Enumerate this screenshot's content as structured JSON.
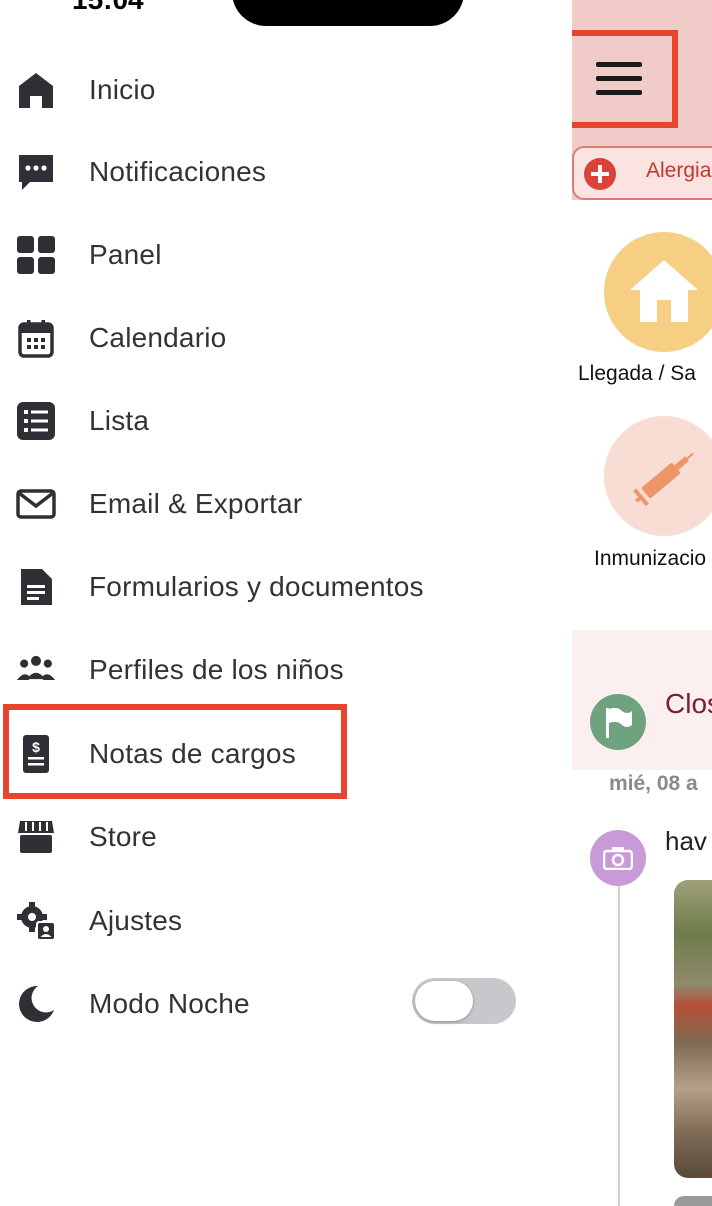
{
  "status_bar": {
    "time": "15:04"
  },
  "menu": {
    "items": [
      {
        "label": "Inicio",
        "icon": "home-icon"
      },
      {
        "label": "Notificaciones",
        "icon": "chat-bubble-icon"
      },
      {
        "label": "Panel",
        "icon": "grid-icon"
      },
      {
        "label": "Calendario",
        "icon": "calendar-icon"
      },
      {
        "label": "Lista",
        "icon": "list-icon"
      },
      {
        "label": "Email & Exportar",
        "icon": "envelope-icon"
      },
      {
        "label": "Formularios y documentos",
        "icon": "document-icon"
      },
      {
        "label": "Perfiles de los niños",
        "icon": "group-icon"
      },
      {
        "label": "Notas de cargos",
        "icon": "invoice-icon"
      },
      {
        "label": "Store",
        "icon": "store-icon"
      },
      {
        "label": "Ajustes",
        "icon": "settings-icon"
      },
      {
        "label": "Modo Noche",
        "icon": "moon-icon"
      }
    ],
    "night_mode_on": false
  },
  "background_app": {
    "allergy_label": "Alergia",
    "tile_1_label": "Llegada / Sa",
    "tile_2_label": "Inmunizacio",
    "event_title": "Clos",
    "date_label": "mié, 08 a",
    "post_label": "hav"
  },
  "colors": {
    "highlight": "#e8432d",
    "header_bg": "#f0cbc8",
    "home_tile": "#f6cf84",
    "vaccine_tile": "#f7ddd3",
    "flag_circle": "#6fa380",
    "camera_circle": "#c89bd8",
    "event_text": "#7a1f2b"
  }
}
